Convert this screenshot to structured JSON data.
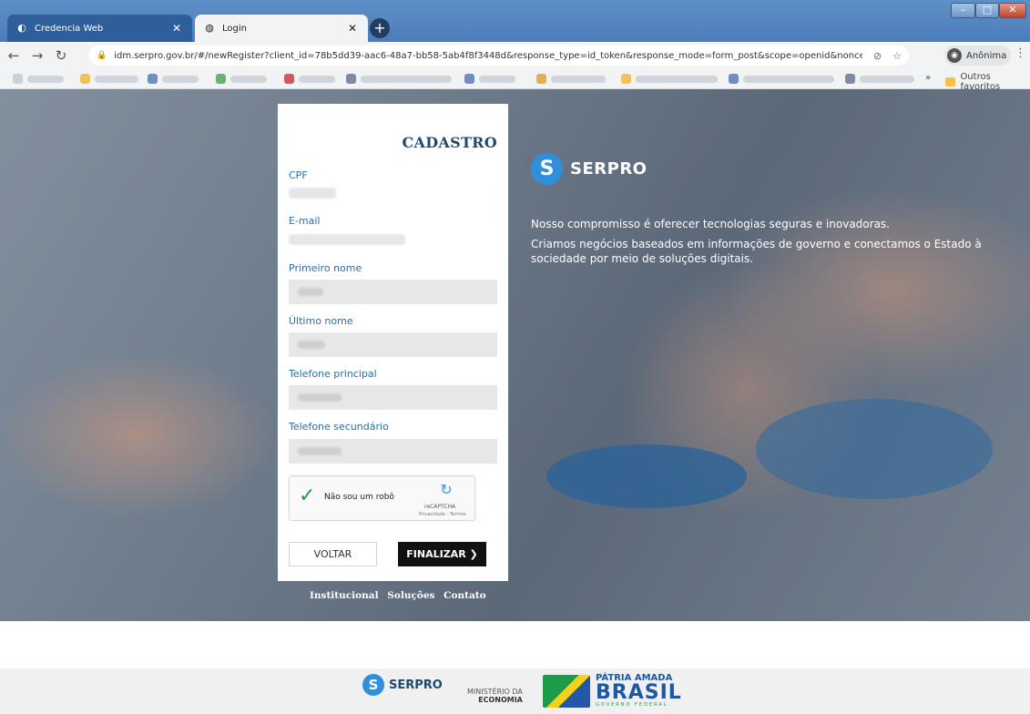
{
  "browser": {
    "tabs": [
      {
        "label": "Credencia Web",
        "icon": "serpro-favicon"
      },
      {
        "label": "Login",
        "icon": "globe-favicon"
      }
    ],
    "new_tab_label": "+",
    "url": "idm.serpro.gov.br/#/newRegister?client_id=78b5dd39-aac6-48a7-bb58-5ab4f8f3448d&response_type=id_token&response_mode=form_post&scope=openid&nonce=u...",
    "profile_label": "Anônima",
    "bookmarks_more": "»",
    "other_bookmarks": "Outros favoritos"
  },
  "form": {
    "title": "CADASTRO",
    "fields": [
      {
        "label": "CPF"
      },
      {
        "label": "E-mail"
      },
      {
        "label": "Primeiro nome"
      },
      {
        "label": "Último nome"
      },
      {
        "label": "Telefone principal"
      },
      {
        "label": "Telefone secundário"
      }
    ],
    "captcha": {
      "label": "Não sou um robô",
      "brand": "reCAPTCHA",
      "terms": "Privacidade - Termos"
    },
    "back_label": "VOLTAR",
    "finish_label": "FINALIZAR ❯"
  },
  "links": [
    "Institucional",
    "Soluções",
    "Contato"
  ],
  "brand": {
    "name": "SERPRO",
    "tagline_1": "Nosso compromisso é oferecer tecnologias seguras e inovadoras.",
    "tagline_2": "Criamos negócios baseados em informações de governo e conectamos o Estado à sociedade por meio de soluções digitais."
  },
  "footer": {
    "serpro": "SERPRO",
    "ministerio_1": "MINISTÉRIO DA",
    "ministerio_2": "ECONOMIA",
    "patria_1": "PÁTRIA AMADA",
    "patria_2": "BRASIL",
    "patria_3": "GOVERNO FEDERAL"
  },
  "colors": {
    "accent": "#2c6da3",
    "title": "#1f4a6f",
    "finish_button": "#111111",
    "serpro_blue": "#2f8fdc"
  }
}
